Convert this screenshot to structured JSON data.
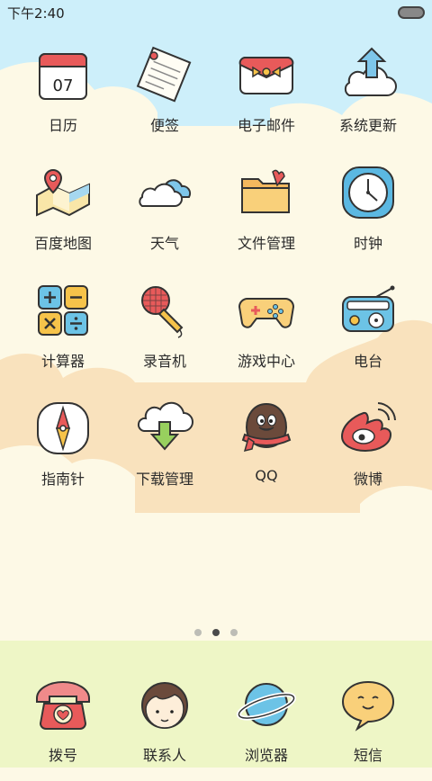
{
  "status_bar": {
    "time": "下午2:40"
  },
  "apps": [
    {
      "label": "日历",
      "icon": "calendar-icon",
      "calendar_day": "07"
    },
    {
      "label": "便签",
      "icon": "note-icon"
    },
    {
      "label": "电子邮件",
      "icon": "mail-icon"
    },
    {
      "label": "系统更新",
      "icon": "update-cloud-icon"
    },
    {
      "label": "百度地图",
      "icon": "map-icon"
    },
    {
      "label": "天气",
      "icon": "weather-cloud-icon"
    },
    {
      "label": "文件管理",
      "icon": "folder-icon"
    },
    {
      "label": "时钟",
      "icon": "clock-icon"
    },
    {
      "label": "计算器",
      "icon": "calculator-icon"
    },
    {
      "label": "录音机",
      "icon": "microphone-icon"
    },
    {
      "label": "游戏中心",
      "icon": "gamepad-icon"
    },
    {
      "label": "电台",
      "icon": "radio-icon"
    },
    {
      "label": "指南针",
      "icon": "compass-icon"
    },
    {
      "label": "下载管理",
      "icon": "download-cloud-icon"
    },
    {
      "label": "QQ",
      "icon": "penguin-icon"
    },
    {
      "label": "微博",
      "icon": "weibo-icon"
    }
  ],
  "page_indicator": {
    "count": 3,
    "active": 2
  },
  "dock": [
    {
      "label": "拨号",
      "icon": "phone-icon"
    },
    {
      "label": "联系人",
      "icon": "contact-face-icon"
    },
    {
      "label": "浏览器",
      "icon": "planet-icon"
    },
    {
      "label": "短信",
      "icon": "message-bubble-icon"
    }
  ],
  "colors": {
    "sky": "#cdeffa",
    "cream": "#fdf9e6",
    "peach": "#f9e2bd",
    "dock": "#eef6c6"
  }
}
